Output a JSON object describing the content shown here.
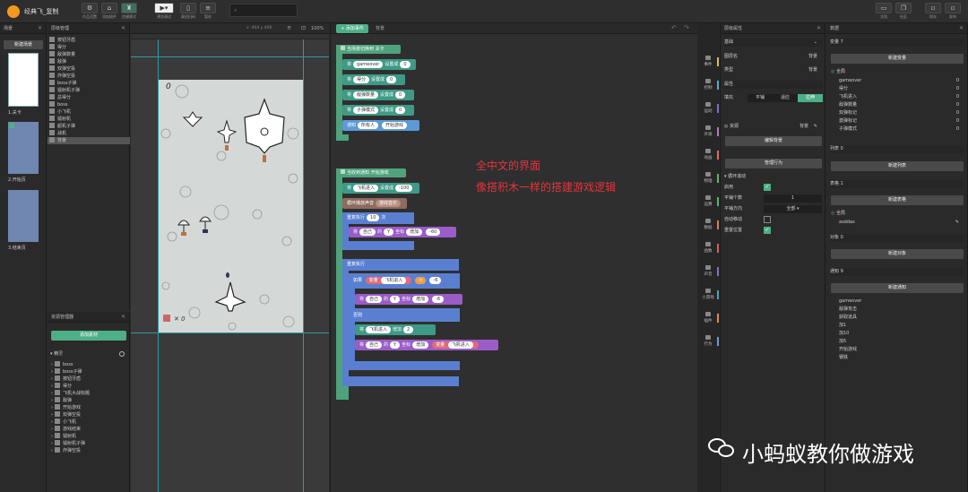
{
  "app": {
    "title": "经典飞_复制",
    "search_placeholder": ""
  },
  "toolbar": {
    "left": [
      {
        "label": "作品设置",
        "icon": "gear-icon"
      },
      {
        "label": "添加插件",
        "icon": "puzzle-icon"
      },
      {
        "label": "控键模式",
        "icon": "gamepad-icon"
      }
    ],
    "run": [
      {
        "label": "预览调试",
        "icon": "play-icon"
      },
      {
        "label": "真机扫码",
        "icon": "phone-icon"
      },
      {
        "label": "暂存",
        "icon": "list-icon"
      }
    ],
    "right": [
      {
        "label": "文档",
        "icon": "doc-icon"
      },
      {
        "label": "社区",
        "icon": "community-icon"
      },
      {
        "label": "保存",
        "icon": "save-icon"
      },
      {
        "label": "发布",
        "icon": "publish-icon"
      }
    ]
  },
  "scene_panel": {
    "title": "场景",
    "new_button": "新建场景",
    "scenes": [
      "1.关卡",
      "2.开始页",
      "3.结束页"
    ]
  },
  "layer_panel": {
    "title": "层级管理",
    "items": [
      "按钮牙盾",
      "得分",
      "敌弹数量",
      "敌弹",
      "双弹空投",
      "炸弹空投",
      "boss子弹",
      "镭射机子弹",
      "总得分",
      "boss",
      "小飞机",
      "镭射机",
      "超机子弹",
      "战机",
      "背景"
    ],
    "selected": "背景"
  },
  "stage": {
    "zoom": "100%",
    "coords": "x -404  y 400",
    "score": "0",
    "bombs": "✕ 0"
  },
  "assets_panel": {
    "title": "资源管理器",
    "add_button": "添加素材",
    "group": "精灵",
    "items": [
      "boss",
      "boss子弹",
      "按钮牙盾",
      "得分",
      "飞机大战标题",
      "敌弹",
      "开始游戏",
      "双弹空投",
      "小飞机",
      "游戏结束",
      "镭射机",
      "镭射机子弹",
      "炸弹空投"
    ]
  },
  "script": {
    "add_event": "添加事件",
    "tab": "背景",
    "event1": "当场景切换到 关卡",
    "b1": [
      "将",
      "gameover",
      "设置成",
      "0"
    ],
    "b2": [
      "将",
      "得分",
      "设置成",
      "0"
    ],
    "b3": [
      "将",
      "敌弹数量",
      "设置成",
      "0"
    ],
    "b4": [
      "将",
      "子弹模式",
      "设置成",
      "0"
    ],
    "b5": [
      "通知",
      "所有人",
      "开始游戏"
    ],
    "event2": "当收到通知 开始游戏",
    "c1": [
      "将",
      "飞机进入",
      "设置成",
      "-100"
    ],
    "c2": [
      "循环播放声音",
      "游戏音乐"
    ],
    "c3": [
      "重复执行",
      "10",
      "次"
    ],
    "c4": [
      "将",
      "自己",
      "的",
      "Y",
      "坐标",
      "增加",
      "-60"
    ],
    "c5": "重复执行",
    "c6": [
      "如果",
      "变量",
      "飞机进入",
      "<",
      "-6"
    ],
    "c7": [
      "将",
      "自己",
      "的",
      "Y",
      "坐标",
      "增加",
      "-6"
    ],
    "c8": "否则",
    "c9": [
      "将",
      "飞机进入",
      "增加",
      "2"
    ],
    "c10": [
      "将",
      "自己",
      "的",
      "Y",
      "坐标",
      "增加",
      "变量",
      "飞机进入"
    ]
  },
  "overlay": {
    "line1": "全中文的界面",
    "line2": "像搭积木一样的搭建游戏逻辑"
  },
  "categories": [
    "事件",
    "控制",
    "运动",
    "外观",
    "动画",
    "物理",
    "运算",
    "数据",
    "函数",
    "声音",
    "小游戏",
    "插件",
    "行为"
  ],
  "category_colors": [
    "#e5b84b",
    "#5ba8d9",
    "#7b6ad6",
    "#c46ed0",
    "#e36b5c",
    "#59b46b",
    "#55b46b",
    "#e07b48",
    "#d45f5f",
    "#8a6ad0",
    "#4aa3c4",
    "#e48b3b",
    "#6c9bd6"
  ],
  "props_panel": {
    "title": "层级属性",
    "basic": "基础",
    "name_label": "图层名",
    "name_value": "背景",
    "type_label": "类型",
    "type_value": "背景",
    "attrs": "属性",
    "fill_label": "填充",
    "fill_options": [
      "平铺",
      "适应",
      "拉伸"
    ],
    "fill_selected": "拉伸",
    "res_label": "资源",
    "res_value": "背景",
    "edit_bg": "编辑背景",
    "manage": "管理行为",
    "loop": "循环滚动",
    "enable_label": "启用",
    "tiles_label": "平铺个数",
    "tiles_value": "1",
    "dir_label": "平铺方向",
    "dir_value": "全部",
    "auto_label": "自动移动",
    "reset_label": "重置位置"
  },
  "data_panel": {
    "title": "数据",
    "vars_header": "变量 7",
    "new_var": "新建变量",
    "scope": "全局",
    "vars": [
      {
        "name": "gameover",
        "value": "0"
      },
      {
        "name": "得分",
        "value": "0"
      },
      {
        "name": "飞机进入",
        "value": "0"
      },
      {
        "name": "敌弹数量",
        "value": "0"
      },
      {
        "name": "双弹标记",
        "value": "0"
      },
      {
        "name": "激弹标记",
        "value": "0"
      },
      {
        "name": "子弹模式",
        "value": "0"
      }
    ],
    "lists_header": "列表 0",
    "new_list": "新建列表",
    "tables_header": "表格 1",
    "new_table": "新建表格",
    "table_scope": "全局",
    "table_name": "asddas",
    "objects_header": "对象 0",
    "new_object": "新建对象",
    "notify_header": "通知 9",
    "new_notify": "新建通知",
    "notifies": [
      "gameover",
      "敌弹攻击",
      "获取道具",
      "加1",
      "加10",
      "加5",
      "开始游戏",
      "钢铁"
    ]
  },
  "watermark": "小蚂蚁教你做游戏"
}
